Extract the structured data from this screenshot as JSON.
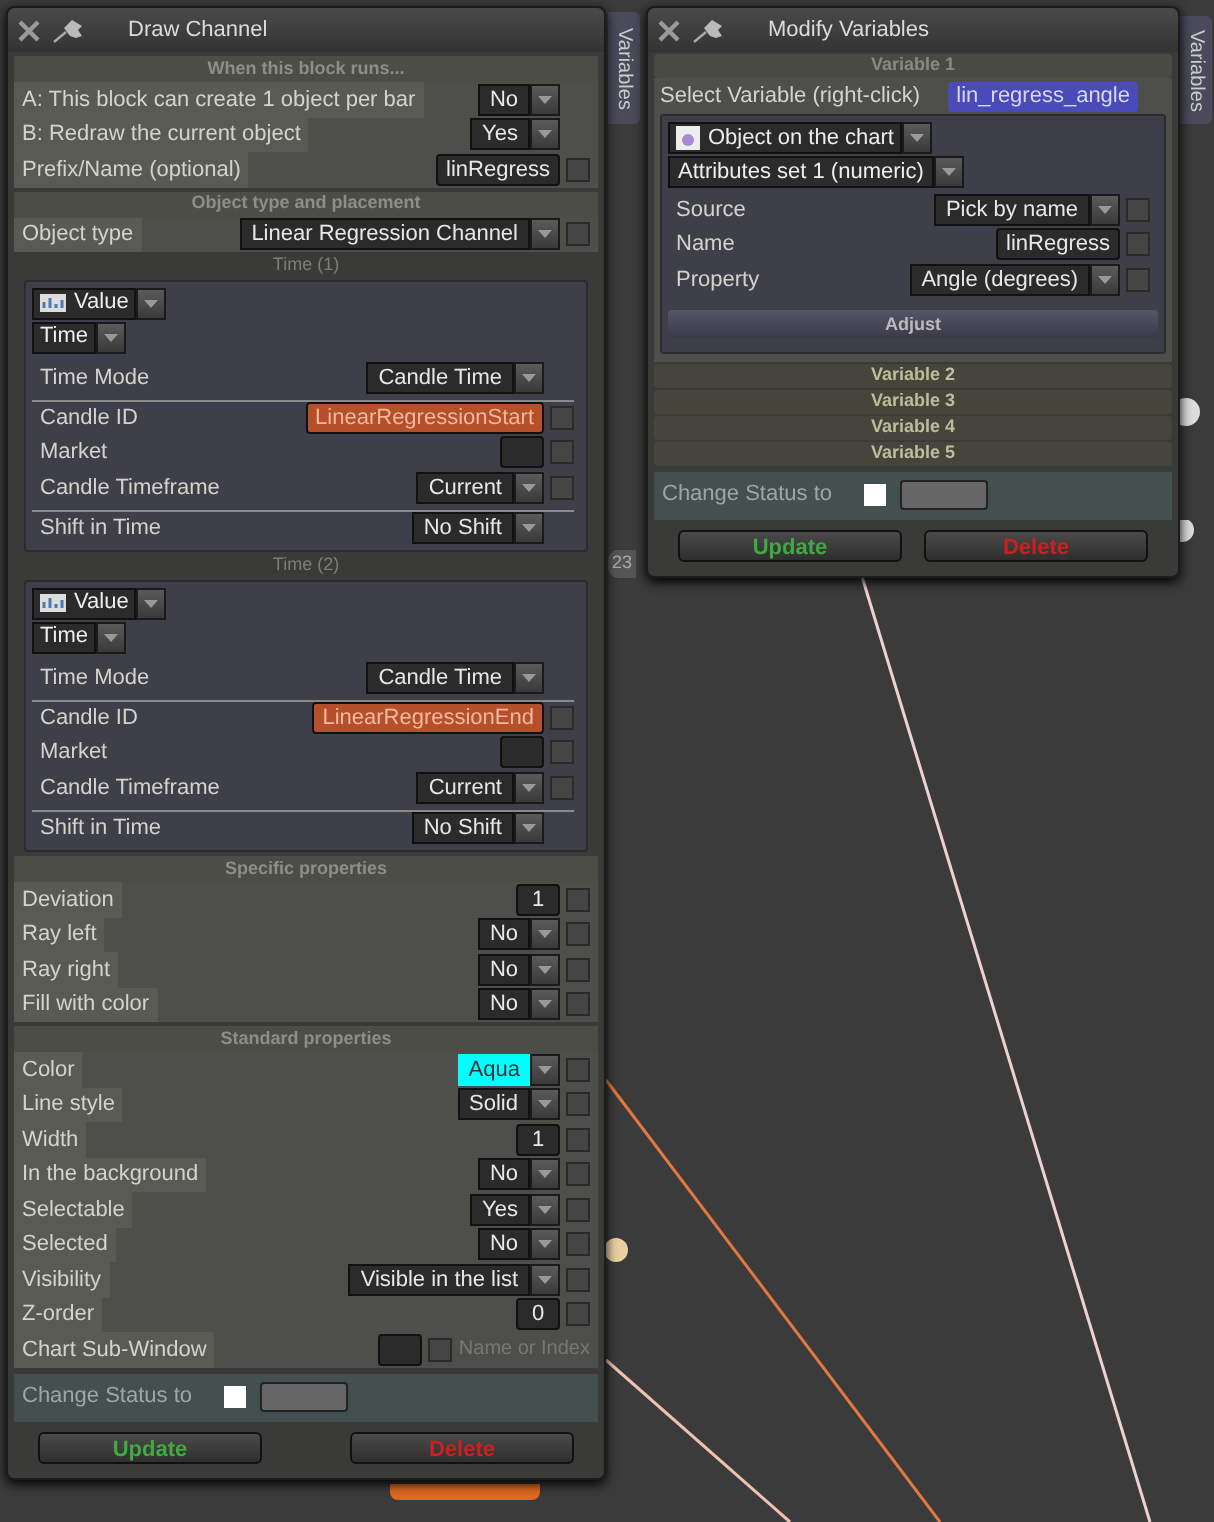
{
  "canvas": {
    "side_tabs": [
      "Variables",
      "Variables"
    ],
    "node_label": "23"
  },
  "left_window": {
    "title": "Draw Channel",
    "sections": [
      {
        "title": "When this block runs...",
        "rows": [
          {
            "kind": "dropdown",
            "label": "A: This block can create 1 object per bar",
            "value": "No"
          },
          {
            "kind": "dropdown",
            "label": "B: Redraw the current object",
            "value": "Yes"
          },
          {
            "kind": "input",
            "label": "Prefix/Name (optional)",
            "value": "linRegress",
            "checked": false
          }
        ]
      },
      {
        "title": "Object type and placement",
        "rows": [
          {
            "kind": "dropdown",
            "label": "Object type",
            "value": "Linear Regression Channel",
            "checked": false
          }
        ],
        "groups": [
          {
            "caption": "Time (1)",
            "source": "Value",
            "type": "Time",
            "rows": [
              {
                "kind": "dropdown",
                "label": "Time Mode",
                "value": "Candle Time",
                "separator": false
              },
              {
                "kind": "variable",
                "label": "Candle ID",
                "value": "LinearRegressionStart",
                "checked": false,
                "separator": true
              },
              {
                "kind": "input",
                "label": "Market",
                "checked": false,
                "separator": false
              },
              {
                "kind": "dropdown",
                "label": "Candle Timeframe",
                "value": "Current",
                "checked": false,
                "separator": false
              },
              {
                "kind": "dropdown",
                "label": "Shift in Time",
                "value": "No Shift",
                "separator": true
              }
            ]
          },
          {
            "caption": "Time (2)",
            "source": "Value",
            "type": "Time",
            "rows": [
              {
                "kind": "dropdown",
                "label": "Time Mode",
                "value": "Candle Time",
                "separator": false
              },
              {
                "kind": "variable",
                "label": "Candle ID",
                "value": "LinearRegressionEnd",
                "checked": false,
                "separator": true
              },
              {
                "kind": "input",
                "label": "Market",
                "checked": false,
                "separator": false
              },
              {
                "kind": "dropdown",
                "label": "Candle Timeframe",
                "value": "Current",
                "checked": false,
                "separator": false
              },
              {
                "kind": "dropdown",
                "label": "Shift in Time",
                "value": "No Shift",
                "separator": true
              }
            ]
          }
        ]
      },
      {
        "title": "Specific properties",
        "rows": [
          {
            "kind": "input",
            "label": "Deviation",
            "value": "1",
            "checked": false
          },
          {
            "kind": "dropdown",
            "label": "Ray left",
            "value": "No",
            "checked": false
          },
          {
            "kind": "dropdown",
            "label": "Ray right",
            "value": "No",
            "checked": false
          },
          {
            "kind": "dropdown",
            "label": "Fill with color",
            "value": "No",
            "checked": false
          }
        ]
      },
      {
        "title": "Standard properties",
        "rows": [
          {
            "kind": "color",
            "label": "Color",
            "value": "Aqua",
            "color": "#00ffff",
            "checked": false
          },
          {
            "kind": "dropdown",
            "label": "Line style",
            "value": "Solid",
            "checked": false
          },
          {
            "kind": "input",
            "label": "Width",
            "value": "1",
            "checked": false
          },
          {
            "kind": "dropdown",
            "label": "In the background",
            "value": "No",
            "checked": false
          },
          {
            "kind": "dropdown",
            "label": "Selectable",
            "value": "Yes",
            "checked": false
          },
          {
            "kind": "dropdown",
            "label": "Selected",
            "value": "No",
            "checked": false
          },
          {
            "kind": "dropdown",
            "label": "Visibility",
            "value": "Visible in the list",
            "checked": false
          },
          {
            "kind": "input",
            "label": "Z-order",
            "value": "0",
            "checked": false
          },
          {
            "kind": "input",
            "label": "Chart Sub-Window",
            "checked": false,
            "hint": "Name or Index"
          }
        ]
      }
    ],
    "change_status": {
      "label": "Change Status to",
      "checked": false
    },
    "buttons": [
      {
        "label": "Update",
        "kind": "update"
      },
      {
        "label": "Delete",
        "kind": "delete"
      }
    ]
  },
  "right_window": {
    "title": "Modify Variables",
    "variables": [
      {
        "title": "Variable 1",
        "expanded": true,
        "select_label": "Select Variable (right-click)",
        "variable": "lin_regress_angle",
        "source_type": "Object on the chart",
        "attributes": "Attributes set 1 (numeric)",
        "rows": [
          {
            "kind": "dropdown",
            "label": "Source",
            "value": "Pick by name",
            "checked": false
          },
          {
            "kind": "input",
            "label": "Name",
            "value": "linRegress",
            "checked": false
          },
          {
            "kind": "dropdown",
            "label": "Property",
            "value": "Angle (degrees)",
            "checked": false
          }
        ],
        "action": "Adjust"
      },
      {
        "title": "Variable 2",
        "expanded": false
      },
      {
        "title": "Variable 3",
        "expanded": false
      },
      {
        "title": "Variable 4",
        "expanded": false
      },
      {
        "title": "Variable 5",
        "expanded": false
      }
    ],
    "change_status": {
      "label": "Change Status to",
      "checked": false
    },
    "buttons": [
      {
        "label": "Update",
        "kind": "update"
      },
      {
        "label": "Delete",
        "kind": "delete"
      }
    ]
  }
}
